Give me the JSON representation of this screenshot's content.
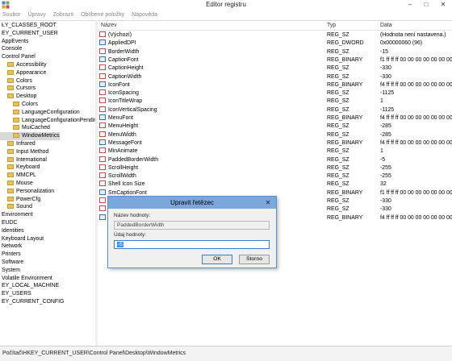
{
  "window": {
    "title": "Editor registru",
    "minimize": "–",
    "maximize": "□",
    "close": "✕"
  },
  "menu": [
    "Soubor",
    "Úpravy",
    "Zobrazit",
    "Oblíbené položky",
    "Nápověda"
  ],
  "tree": [
    {
      "label": "ŁY_CLASSES_ROOT",
      "indent": 0,
      "folder": false
    },
    {
      "label": "EY_CURRENT_USER",
      "indent": 0,
      "folder": false
    },
    {
      "label": "AppEvents",
      "indent": 0,
      "folder": false
    },
    {
      "label": "Console",
      "indent": 0,
      "folder": false
    },
    {
      "label": "Control Panel",
      "indent": 0,
      "folder": false
    },
    {
      "label": "Accessibility",
      "indent": 1,
      "folder": true
    },
    {
      "label": "Appearance",
      "indent": 1,
      "folder": true
    },
    {
      "label": "Colors",
      "indent": 1,
      "folder": true
    },
    {
      "label": "Cursors",
      "indent": 1,
      "folder": true
    },
    {
      "label": "Desktop",
      "indent": 1,
      "folder": true
    },
    {
      "label": "Colors",
      "indent": 2,
      "folder": true
    },
    {
      "label": "LanguageConfiguration",
      "indent": 2,
      "folder": true
    },
    {
      "label": "LanguageConfigurationPending",
      "indent": 2,
      "folder": true
    },
    {
      "label": "MuiCached",
      "indent": 2,
      "folder": true
    },
    {
      "label": "WindowMetrics",
      "indent": 2,
      "folder": true,
      "selected": true
    },
    {
      "label": "Infrared",
      "indent": 1,
      "folder": true
    },
    {
      "label": "Input Method",
      "indent": 1,
      "folder": true
    },
    {
      "label": "International",
      "indent": 1,
      "folder": true
    },
    {
      "label": "Keyboard",
      "indent": 1,
      "folder": true
    },
    {
      "label": "MMCPL",
      "indent": 1,
      "folder": true
    },
    {
      "label": "Mouse",
      "indent": 1,
      "folder": true
    },
    {
      "label": "Personalization",
      "indent": 1,
      "folder": true
    },
    {
      "label": "PowerCfg",
      "indent": 1,
      "folder": true
    },
    {
      "label": "Sound",
      "indent": 1,
      "folder": true
    },
    {
      "label": "Environment",
      "indent": 0,
      "folder": false
    },
    {
      "label": "EUDC",
      "indent": 0,
      "folder": false
    },
    {
      "label": "Identities",
      "indent": 0,
      "folder": false
    },
    {
      "label": "Keyboard Layout",
      "indent": 0,
      "folder": false
    },
    {
      "label": "Network",
      "indent": 0,
      "folder": false
    },
    {
      "label": "Printers",
      "indent": 0,
      "folder": false
    },
    {
      "label": "Software",
      "indent": 0,
      "folder": false
    },
    {
      "label": "System",
      "indent": 0,
      "folder": false
    },
    {
      "label": "Volatile Environment",
      "indent": 0,
      "folder": false
    },
    {
      "label": "EY_LOCAL_MACHINE",
      "indent": 0,
      "folder": false
    },
    {
      "label": "EY_USERS",
      "indent": 0,
      "folder": false
    },
    {
      "label": "EY_CURRENT_CONFIG",
      "indent": 0,
      "folder": false
    }
  ],
  "list": {
    "headers": {
      "name": "Název",
      "type": "Typ",
      "data": "Data"
    },
    "rows": [
      {
        "name": "(Výchozí)",
        "type": "REG_SZ",
        "data": "(Hodnota není nastavena.)",
        "icon": "ab"
      },
      {
        "name": "AppliedDPI",
        "type": "REG_DWORD",
        "data": "0x00000060 (96)",
        "icon": "bin"
      },
      {
        "name": "BorderWidth",
        "type": "REG_SZ",
        "data": "-15",
        "icon": "ab"
      },
      {
        "name": "CaptionFont",
        "type": "REG_BINARY",
        "data": "f1 ff ff ff 00 00 00 00 00 00 00 00 0",
        "icon": "bin"
      },
      {
        "name": "CaptionHeight",
        "type": "REG_SZ",
        "data": "-330",
        "icon": "ab"
      },
      {
        "name": "CaptionWidth",
        "type": "REG_SZ",
        "data": "-330",
        "icon": "ab"
      },
      {
        "name": "IconFont",
        "type": "REG_BINARY",
        "data": "f4 ff ff ff 00 00 00 00 00 00 00 00 0",
        "icon": "bin"
      },
      {
        "name": "IconSpacing",
        "type": "REG_SZ",
        "data": "-1125",
        "icon": "ab"
      },
      {
        "name": "IconTitleWrap",
        "type": "REG_SZ",
        "data": "1",
        "icon": "ab"
      },
      {
        "name": "IconVerticalSpacing",
        "type": "REG_SZ",
        "data": "-1125",
        "icon": "ab"
      },
      {
        "name": "MenuFont",
        "type": "REG_BINARY",
        "data": "f4 ff ff ff 00 00 00 00 00 00 00 00 0",
        "icon": "bin"
      },
      {
        "name": "MenuHeight",
        "type": "REG_SZ",
        "data": "-285",
        "icon": "ab"
      },
      {
        "name": "MenuWidth",
        "type": "REG_SZ",
        "data": "-285",
        "icon": "ab"
      },
      {
        "name": "MessageFont",
        "type": "REG_BINARY",
        "data": "f4 ff ff ff 00 00 00 00 00 00 00 00 0",
        "icon": "bin"
      },
      {
        "name": "MinAnimate",
        "type": "REG_SZ",
        "data": "1",
        "icon": "ab"
      },
      {
        "name": "PaddedBorderWidth",
        "type": "REG_SZ",
        "data": "-5",
        "icon": "ab"
      },
      {
        "name": "ScrollHeight",
        "type": "REG_SZ",
        "data": "-255",
        "icon": "ab"
      },
      {
        "name": "ScrollWidth",
        "type": "REG_SZ",
        "data": "-255",
        "icon": "ab"
      },
      {
        "name": "Shell Icon Size",
        "type": "REG_SZ",
        "data": "32",
        "icon": "ab"
      },
      {
        "name": "SmCaptionFont",
        "type": "REG_BINARY",
        "data": "f1 ff ff ff 00 00 00 00 00 00 00 00 0",
        "icon": "bin"
      },
      {
        "name": "",
        "type": "REG_SZ",
        "data": "-330",
        "icon": "ab"
      },
      {
        "name": "",
        "type": "REG_SZ",
        "data": "-330",
        "icon": "ab"
      },
      {
        "name": "",
        "type": "REG_BINARY",
        "data": "f4 ff ff ff 00 00 00 00 00 00 00 00 0",
        "icon": "bin"
      }
    ]
  },
  "dialog": {
    "title": "Upravit řetězec",
    "close": "✕",
    "name_label": "Název hodnoty:",
    "name_value": "PaddedBorderWidth",
    "data_label": "Údaj hodnoty:",
    "data_value": "-5",
    "ok": "OK",
    "cancel": "Storno"
  },
  "status": "Počítač\\HKEY_CURRENT_USER\\Control Panel\\Desktop\\WindowMetrics",
  "colors": {
    "dialog_title": "#7aa7dc",
    "selection": "#3399ff",
    "folder": "#e8c15a"
  },
  "icons": {
    "string_value": "ab-icon",
    "binary_value": "binary-icon",
    "folder": "folder-icon",
    "app": "registry-icon"
  }
}
